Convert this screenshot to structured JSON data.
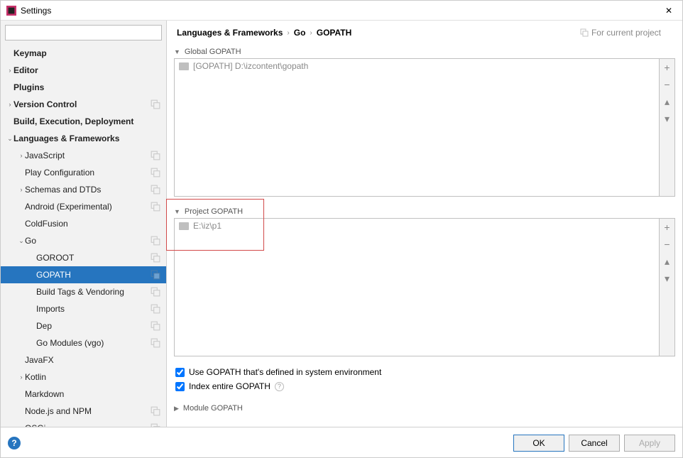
{
  "window": {
    "title": "Settings"
  },
  "search": {
    "placeholder": ""
  },
  "sidebar": {
    "items": [
      {
        "label": "Keymap",
        "bold": true,
        "indent": 0,
        "arrow": "",
        "badge": false
      },
      {
        "label": "Editor",
        "bold": true,
        "indent": 0,
        "arrow": "›",
        "badge": false
      },
      {
        "label": "Plugins",
        "bold": true,
        "indent": 0,
        "arrow": "",
        "badge": false
      },
      {
        "label": "Version Control",
        "bold": true,
        "indent": 0,
        "arrow": "›",
        "badge": true
      },
      {
        "label": "Build, Execution, Deployment",
        "bold": true,
        "indent": 0,
        "arrow": "",
        "badge": false
      },
      {
        "label": "Languages & Frameworks",
        "bold": true,
        "indent": 0,
        "arrow": "⌄",
        "badge": false
      },
      {
        "label": "JavaScript",
        "bold": false,
        "indent": 1,
        "arrow": "›",
        "badge": true
      },
      {
        "label": "Play Configuration",
        "bold": false,
        "indent": 1,
        "arrow": "",
        "badge": true
      },
      {
        "label": "Schemas and DTDs",
        "bold": false,
        "indent": 1,
        "arrow": "›",
        "badge": true
      },
      {
        "label": "Android (Experimental)",
        "bold": false,
        "indent": 1,
        "arrow": "",
        "badge": true
      },
      {
        "label": "ColdFusion",
        "bold": false,
        "indent": 1,
        "arrow": "",
        "badge": false
      },
      {
        "label": "Go",
        "bold": false,
        "indent": 1,
        "arrow": "⌄",
        "badge": true
      },
      {
        "label": "GOROOT",
        "bold": false,
        "indent": 2,
        "arrow": "",
        "badge": true
      },
      {
        "label": "GOPATH",
        "bold": false,
        "indent": 2,
        "arrow": "",
        "badge": true,
        "selected": true
      },
      {
        "label": "Build Tags & Vendoring",
        "bold": false,
        "indent": 2,
        "arrow": "",
        "badge": true
      },
      {
        "label": "Imports",
        "bold": false,
        "indent": 2,
        "arrow": "",
        "badge": true
      },
      {
        "label": "Dep",
        "bold": false,
        "indent": 2,
        "arrow": "",
        "badge": true
      },
      {
        "label": "Go Modules (vgo)",
        "bold": false,
        "indent": 2,
        "arrow": "",
        "badge": true
      },
      {
        "label": "JavaFX",
        "bold": false,
        "indent": 1,
        "arrow": "",
        "badge": false
      },
      {
        "label": "Kotlin",
        "bold": false,
        "indent": 1,
        "arrow": "›",
        "badge": false
      },
      {
        "label": "Markdown",
        "bold": false,
        "indent": 1,
        "arrow": "",
        "badge": false
      },
      {
        "label": "Node.js and NPM",
        "bold": false,
        "indent": 1,
        "arrow": "",
        "badge": true
      },
      {
        "label": "OSGi",
        "bold": false,
        "indent": 1,
        "arrow": "",
        "badge": true
      }
    ]
  },
  "breadcrumb": {
    "parts": [
      "Languages & Frameworks",
      "Go",
      "GOPATH"
    ],
    "scope": "For current project"
  },
  "sections": {
    "global": {
      "title": "Global GOPATH",
      "entry": "[GOPATH] D:\\izcontent\\gopath"
    },
    "project": {
      "title": "Project GOPATH",
      "entry": "E:\\iz\\p1"
    },
    "module": {
      "title": "Module GOPATH"
    }
  },
  "checkboxes": {
    "use_system": "Use GOPATH that's defined in system environment",
    "index_entire": "Index entire GOPATH"
  },
  "buttons": {
    "ok": "OK",
    "cancel": "Cancel",
    "apply": "Apply"
  }
}
